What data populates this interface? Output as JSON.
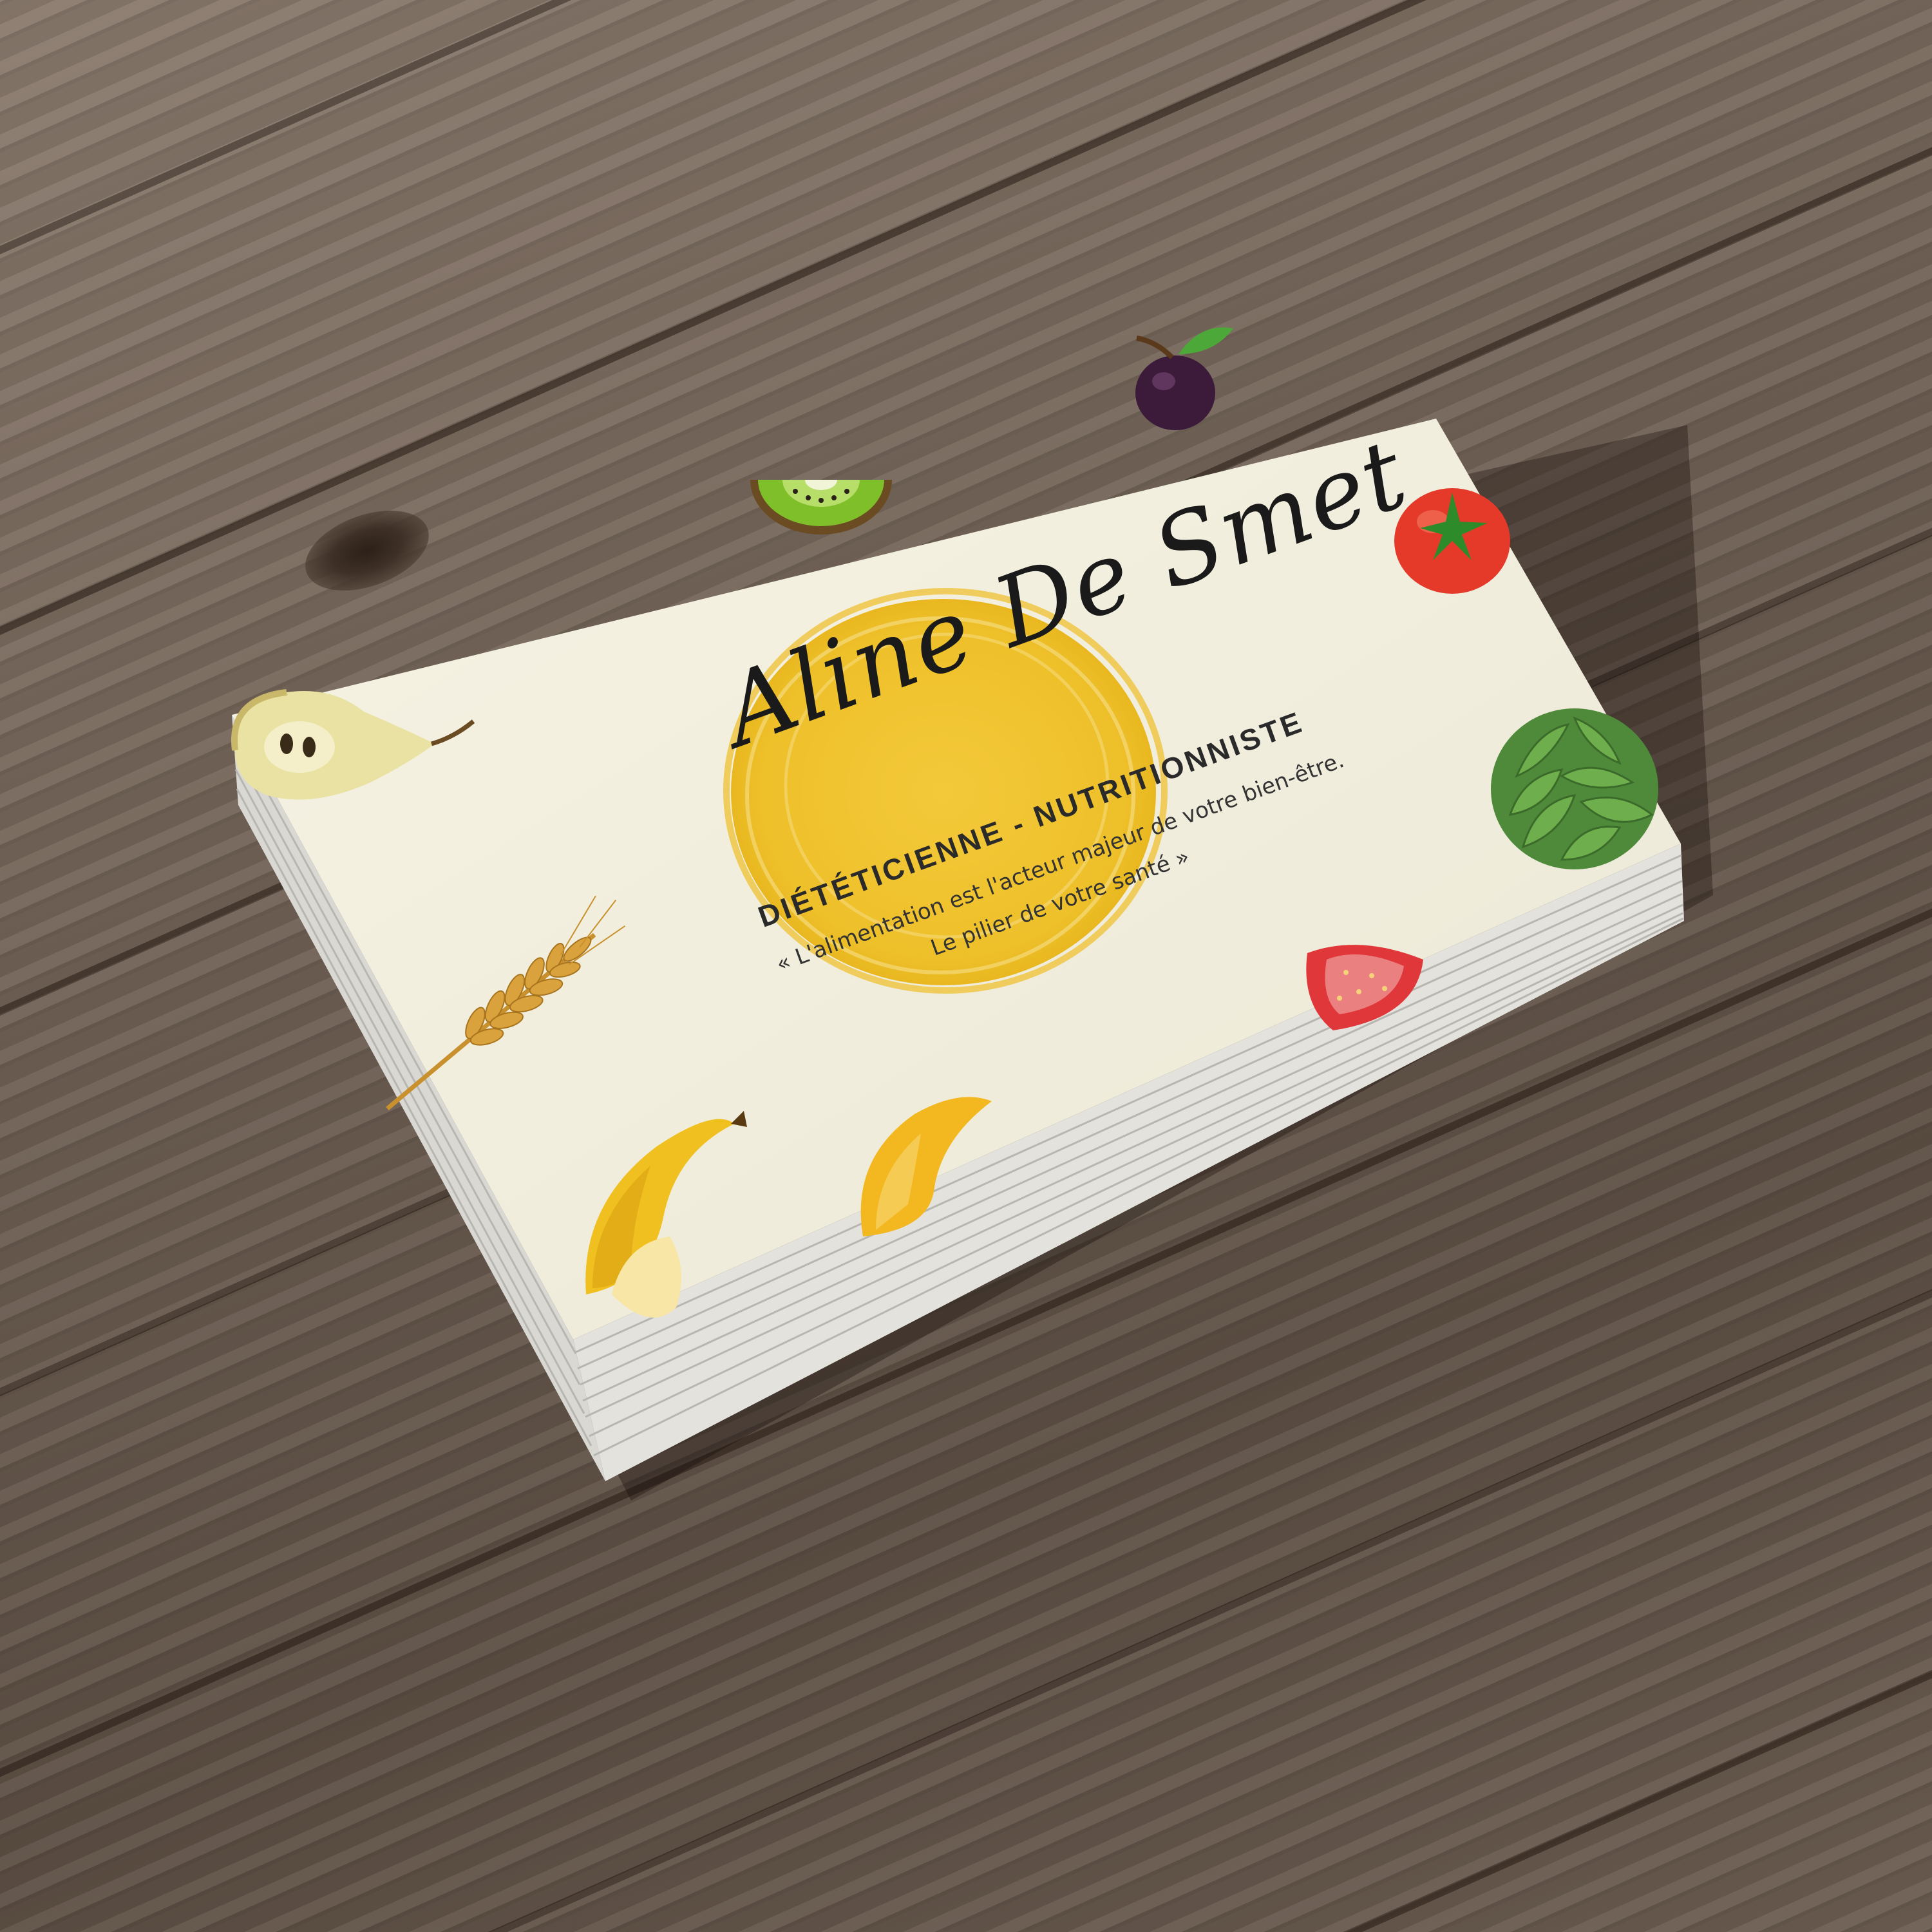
{
  "card": {
    "name": "Aline De Smet",
    "role": "DIÉTÉTICIENNE - NUTRITIONNISTE",
    "quote_line1": "« L'alimentation est l'acteur majeur de votre bien-être.",
    "quote_line2": "Le pilier de votre santé »"
  },
  "colors": {
    "card": "#f3f0e0",
    "accent_yellow": "#f0c42e",
    "wood": "#6f6054"
  },
  "illustrations": [
    "kiwi-icon",
    "plum-icon",
    "tomato-icon",
    "pear-icon",
    "artichoke-icon",
    "wheat-icon",
    "strawberry-icon",
    "banana-icon",
    "mango-icon"
  ]
}
